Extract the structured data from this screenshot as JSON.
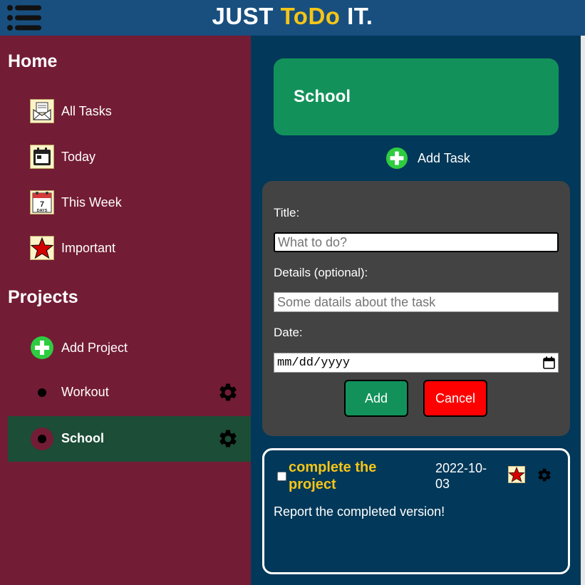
{
  "header": {
    "title_part1": "JUST ",
    "title_accent": "ToDo",
    "title_part2": " IT.",
    "accent_color": "#f5c518",
    "menu_icon": "hamburger-menu-icon"
  },
  "sidebar": {
    "home_heading": "Home",
    "home_items": [
      {
        "label": "All Tasks",
        "icon": "envelope-icon"
      },
      {
        "label": "Today",
        "icon": "calendar-day-icon"
      },
      {
        "label": "This Week",
        "icon": "calendar-week-icon",
        "icon_text_top": "7",
        "icon_text_bottom": "DAYS"
      },
      {
        "label": "Important",
        "icon": "star-icon"
      }
    ],
    "projects_heading": "Projects",
    "add_project_label": "Add Project",
    "projects": [
      {
        "name": "Workout",
        "active": false,
        "settings_icon": "gear-icon"
      },
      {
        "name": "School",
        "active": true,
        "settings_icon": "gear-icon"
      }
    ]
  },
  "main": {
    "project_title": "School",
    "add_task_label": "Add Task",
    "form": {
      "title_label": "Title:",
      "title_placeholder": "What to do?",
      "details_label": "Details (optional):",
      "details_placeholder": "Some datails about the task",
      "date_label": "Date:",
      "date_placeholder": "mm/dd/yyyy",
      "add_button": "Add",
      "cancel_button": "Cancel"
    },
    "tasks": [
      {
        "title": "complete the project",
        "date": "2022-10-03",
        "details": "Report the completed version!",
        "important": true,
        "completed": false
      }
    ]
  },
  "colors": {
    "header_bg": "#184f7f",
    "sidebar_bg": "#731c35",
    "main_bg": "#023859",
    "active_project_bg": "#1c4d36",
    "project_banner_bg": "#12925a",
    "form_bg": "#434343",
    "cancel_bg": "#ff0000",
    "task_title": "#f5c518"
  }
}
